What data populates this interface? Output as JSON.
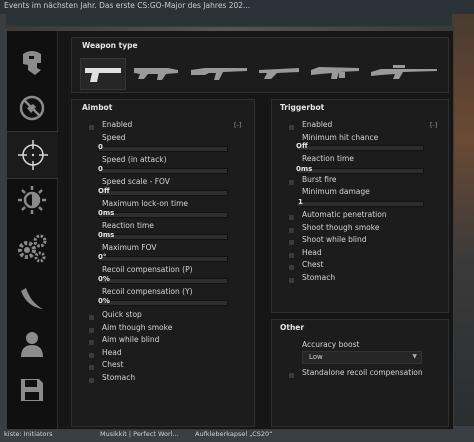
{
  "background": {
    "news_ticker": "Events im nächsten Jahr. Das erste CS:GO-Major des Jahres 202...",
    "bottom_items": [
      "kiste: Initiators",
      "Musikkit | Perfect Worl...",
      "Aufkleberkapsel „CS20“"
    ]
  },
  "sidebar": {
    "tabs": [
      {
        "icon": "ragebot-skull-icon"
      },
      {
        "icon": "antiaim-icon"
      },
      {
        "icon": "crosshair-icon",
        "active": true
      },
      {
        "icon": "visuals-sun-icon"
      },
      {
        "icon": "gears-icon"
      },
      {
        "icon": "knife-icon"
      },
      {
        "icon": "player-icon"
      },
      {
        "icon": "save-icon"
      }
    ]
  },
  "weapon_type": {
    "title": "Weapon type",
    "weapons": [
      "pistol-icon",
      "smg-icon",
      "rifle-icon",
      "shotgun-icon",
      "machinegun-icon",
      "sniper-icon"
    ]
  },
  "aimbot": {
    "title": "Aimbot",
    "enabled_label": "Enabled",
    "key_label": "[-]",
    "sliders": [
      {
        "label": "Speed",
        "value": "0"
      },
      {
        "label": "Speed (in attack)",
        "value": "0"
      },
      {
        "label": "Speed scale - FOV",
        "value": "Off"
      },
      {
        "label": "Maximum lock-on time",
        "value": "0ms"
      },
      {
        "label": "Reaction time",
        "value": "0ms"
      },
      {
        "label": "Maximum FOV",
        "value": "0°"
      },
      {
        "label": "Recoil compensation (P)",
        "value": "0%"
      },
      {
        "label": "Recoil compensation (Y)",
        "value": "0%"
      }
    ],
    "checkboxes": [
      "Quick stop",
      "Aim though smoke",
      "Aim while blind",
      "Head",
      "Chest",
      "Stomach"
    ]
  },
  "triggerbot": {
    "title": "Triggerbot",
    "enabled_label": "Enabled",
    "key_label": "[-]",
    "min_hit_chance_label": "Minimum hit chance",
    "min_hit_chance_value": "Off",
    "reaction_time_label": "Reaction time",
    "reaction_time_value": "0ms",
    "burst_fire_label": "Burst fire",
    "min_damage_label": "Minimum damage",
    "min_damage_value": "1",
    "checkboxes": [
      "Automatic penetration",
      "Shoot though smoke",
      "Shoot while blind",
      "Head",
      "Chest",
      "Stomach"
    ]
  },
  "other": {
    "title": "Other",
    "accuracy_boost_label": "Accuracy boost",
    "accuracy_boost_value": "Low",
    "standalone_rcs_label": "Standalone recoil compensation"
  }
}
